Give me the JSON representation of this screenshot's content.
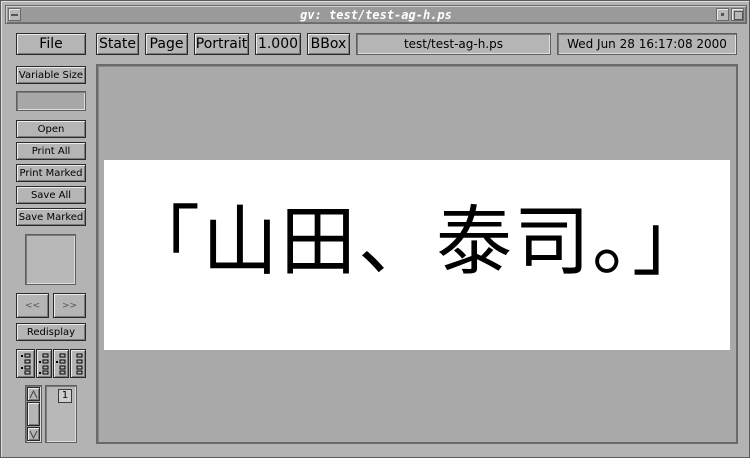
{
  "window": {
    "title": "gv: test/test-ag-h.ps"
  },
  "toolbar": {
    "file_label": "File",
    "state_label": "State",
    "page_label": "Page",
    "orientation_label": "Portrait",
    "zoom_label": "1.000",
    "bbox_label": "BBox",
    "filename": "test/test-ag-h.ps",
    "datetime": "Wed Jun 28 16:17:08 2000"
  },
  "sidebar": {
    "size_label": "Variable Size",
    "open_label": "Open",
    "print_all_label": "Print All",
    "print_marked_label": "Print Marked",
    "save_all_label": "Save All",
    "save_marked_label": "Save Marked",
    "prev_label": "<<",
    "next_label": ">>",
    "redisplay_label": "Redisplay",
    "page_number": "1"
  },
  "document": {
    "text": "「山田、泰司。」"
  }
}
